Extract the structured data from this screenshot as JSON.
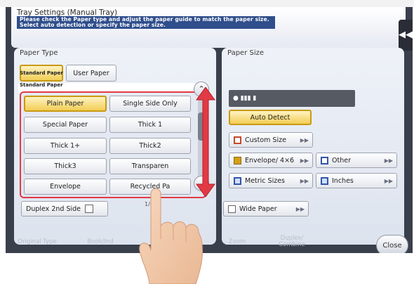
{
  "window": {
    "title": "Tray Settings (Manual Tray)"
  },
  "header": {
    "message": "Please check the Paper type and adjust the paper guide to match the paper size. Select auto detection or specify the paper size."
  },
  "paper_type": {
    "section_label": "Paper Type",
    "tabs": [
      {
        "label": "Standard Paper",
        "selected": true
      },
      {
        "label": "User Paper",
        "selected": false
      }
    ],
    "list_header": "Standard Paper",
    "options": [
      {
        "label": "Plain Paper",
        "selected": true
      },
      {
        "label": "Single Side Only",
        "selected": false
      },
      {
        "label": "Special Paper",
        "selected": false
      },
      {
        "label": "Thick 1",
        "selected": false
      },
      {
        "label": "Thick 1+",
        "selected": false
      },
      {
        "label": "Thick2",
        "selected": false
      },
      {
        "label": "Thick3",
        "selected": false
      },
      {
        "label": "Transparen",
        "selected": false
      },
      {
        "label": "Envelope",
        "selected": false
      },
      {
        "label": "Recycled Pa",
        "selected": false
      }
    ],
    "duplex_label": "Duplex 2nd Side",
    "page_indicator": "1/6"
  },
  "paper_size": {
    "section_label": "Paper Size",
    "display_value": "● ▮▮▮ ▮",
    "auto_detect_label": "Auto Detect",
    "custom_size_label": "Custom Size",
    "envelope_label": "Envelope/ 4×6",
    "other_label": "Other",
    "metric_label": "Metric Sizes",
    "inches_label": "Inches",
    "wide_paper_label": "Wide Paper"
  },
  "footer": {
    "tabs": [
      "Original Type",
      "Book/Ind",
      "Zoom",
      "Duplex/ Combine"
    ],
    "close_label": "Close"
  },
  "icons": {
    "collapse": "double-chevron-left-icon",
    "scroll_up": "chevron-up-icon",
    "scroll_down": "chevron-down-icon",
    "overlay_arrow": "red-vertical-double-arrow",
    "hand": "pointing-hand-icon"
  },
  "colors": {
    "header_message_bg": "#2f4e8c",
    "selected_fill": "#f2cd55",
    "highlight_red": "#e23a45",
    "screen_bg": "#3a3f4c"
  }
}
